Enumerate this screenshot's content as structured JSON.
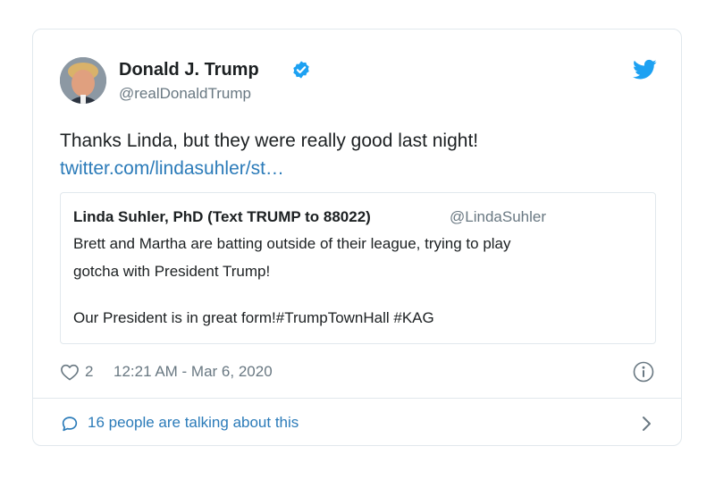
{
  "author": {
    "name": "Donald J. Trump",
    "handle": "@realDonaldTrump"
  },
  "tweet": {
    "text": "Thanks Linda, but they were really good last night!",
    "link": "twitter.com/lindasuhler/st…"
  },
  "quoted": {
    "name": "Linda Suhler, PhD (Text TRUMP to 88022)",
    "handle": "@LindaSuhler",
    "line1": "Brett and Martha are batting outside of their league, trying to play",
    "line2": "gotcha with President Trump!",
    "line3": "Our President is in great form!#TrumpTownHall #KAG"
  },
  "meta": {
    "likes": "2",
    "timestamp": "12:21 AM - Mar 6, 2020"
  },
  "footer": {
    "talking": "16 people are talking about this"
  },
  "icons": {
    "verified": "verified-badge-icon",
    "brand": "twitter-bird-icon",
    "like": "heart-icon",
    "info": "info-icon",
    "comment": "speech-bubble-icon",
    "next": "chevron-right-icon"
  },
  "colors": {
    "link": "#2b7bb9",
    "verified": "#1da1f2",
    "muted": "#697882",
    "border": "#e1e8ed"
  }
}
